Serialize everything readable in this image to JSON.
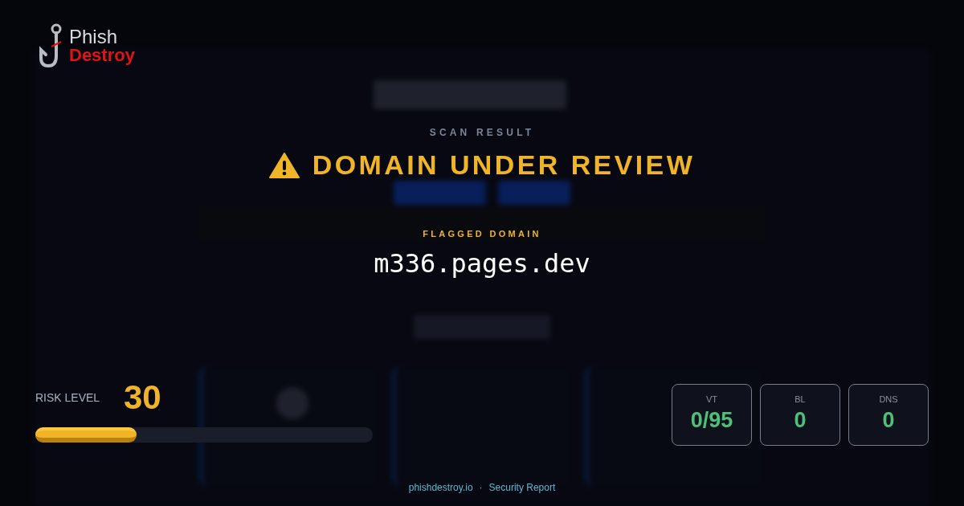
{
  "logo": {
    "line1": "Phish",
    "line2": "Destroy"
  },
  "scan": {
    "eyebrow": "SCAN RESULT",
    "verdict": "DOMAIN UNDER REVIEW",
    "warning": true
  },
  "domain": {
    "label": "FLAGGED DOMAIN",
    "value": "m336.pages.dev"
  },
  "risk": {
    "label": "RISK LEVEL",
    "score": "30",
    "level": 0.3
  },
  "stats": [
    {
      "label": "VT",
      "value": "0/95"
    },
    {
      "label": "BL",
      "value": "0"
    },
    {
      "label": "DNS",
      "value": "0"
    }
  ],
  "footer": {
    "site": "phishdestroy.io",
    "separator": "·",
    "label": "Security Report"
  }
}
